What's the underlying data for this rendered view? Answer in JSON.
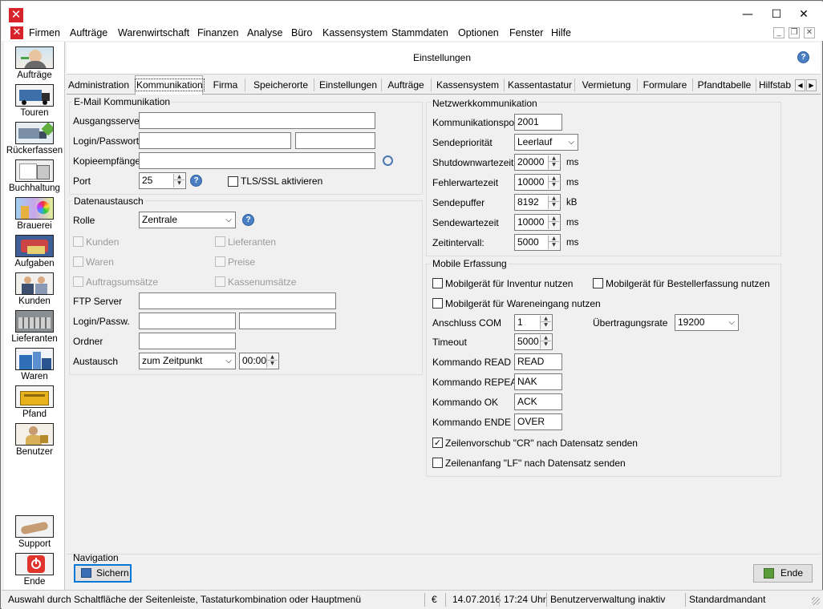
{
  "window": {
    "minimize": "—",
    "maximize": "☐",
    "close": "✕"
  },
  "menu": {
    "items": [
      "Firmen",
      "Aufträge",
      "Warenwirtschaft",
      "Finanzen",
      "Analyse",
      "Büro",
      "Kassensystem",
      "Stammdaten",
      "Optionen",
      "Fenster",
      "Hilfe"
    ],
    "mdi_minimize": "_",
    "mdi_restore": "❐",
    "mdi_close": "✕"
  },
  "sidebar": {
    "items": [
      "Aufträge",
      "Touren",
      "Rückerfassen",
      "Buchhaltung",
      "Brauerei",
      "Aufgaben",
      "Kunden",
      "Lieferanten",
      "Waren",
      "Pfand",
      "Benutzer"
    ],
    "support": "Support",
    "ende": "Ende"
  },
  "header": {
    "title": "Einstellungen",
    "help": "?"
  },
  "tabs": [
    "Administration",
    "Kommunikation",
    "Firma",
    "Speicherorte",
    "Einstellungen",
    "Aufträge",
    "Kassensystem",
    "Kassentastatur",
    "Vermietung",
    "Formulare",
    "Pfandtabelle",
    "Hilfstab"
  ],
  "tab_scroll": {
    "left": "◀",
    "right": "▶"
  },
  "email": {
    "title": "E-Mail Kommunikation",
    "ausgangsserver_label": "Ausgangsserver",
    "ausgangsserver_value": "",
    "login_label": "Login/Passwort",
    "login_value": "",
    "password_value": "",
    "kopie_label": "Kopieempfänger",
    "kopie_value": "",
    "port_label": "Port",
    "port_value": "25",
    "tls_label": "TLS/SSL aktivieren",
    "tls_checked": false
  },
  "daten": {
    "title": "Datenaustausch",
    "rolle_label": "Rolle",
    "rolle_value": "Zentrale",
    "kunden": "Kunden",
    "lieferanten": "Lieferanten",
    "waren": "Waren",
    "preise": "Preise",
    "auftragsumsaetze": "Auftragsumsätze",
    "kassenumsaetze": "Kassenumsätze",
    "ftp_label": "FTP Server",
    "ftp_value": "",
    "login_label": "Login/Passw.",
    "login_value": "",
    "password_value": "",
    "ordner_label": "Ordner",
    "ordner_value": "",
    "austausch_label": "Austausch",
    "austausch_value": "zum Zeitpunkt",
    "zeit_value": "00:00"
  },
  "netzwerk": {
    "title": "Netzwerkkommunikation",
    "port_label": "Kommunikationsport",
    "port_value": "2001",
    "prio_label": "Sendepriorität",
    "prio_value": "Leerlauf",
    "shutdown_label": "Shutdownwartezeit",
    "shutdown_value": "20000",
    "shutdown_unit": "ms",
    "fehler_label": "Fehlerwartezeit",
    "fehler_value": "10000",
    "fehler_unit": "ms",
    "puffer_label": "Sendepuffer",
    "puffer_value": "8192",
    "puffer_unit": "kB",
    "sendewarte_label": "Sendewartezeit",
    "sendewarte_value": "10000",
    "sendewarte_unit": "ms",
    "intervall_label": "Zeitintervall:",
    "intervall_value": "5000",
    "intervall_unit": "ms"
  },
  "mobile": {
    "title": "Mobile Erfassung",
    "inventur": "Mobilgerät für Inventur nutzen",
    "bestell": "Mobilgerät für Bestellerfassung nutzen",
    "wareneingang": "Mobilgerät für Wareneingang nutzen",
    "com_label": "Anschluss COM",
    "com_value": "1",
    "rate_label": "Übertragungsrate",
    "rate_value": "19200",
    "timeout_label": "Timeout",
    "timeout_value": "5000",
    "read_label": "Kommando READ",
    "read_value": "READ",
    "repeat_label": "Kommando REPEAT",
    "repeat_value": "NAK",
    "ok_label": "Kommando OK",
    "ok_value": "ACK",
    "ende_label": "Kommando ENDE",
    "ende_value": "OVER",
    "cr_label": "Zeilenvorschub \"CR\" nach Datensatz senden",
    "cr_checked": true,
    "lf_label": "Zeilenanfang \"LF\" nach Datensatz senden",
    "lf_checked": false
  },
  "navigation": {
    "title": "Navigation",
    "save": "Sichern",
    "end": "Ende"
  },
  "status": {
    "hint": "Auswahl durch Schaltfläche der Seitenleiste, Tastaturkombination oder Hauptmenü",
    "currency": "€",
    "date": "14.07.2016",
    "time": "17:24 Uhr",
    "user": "Benutzerverwaltung inaktiv",
    "mandant": "Standardmandant"
  },
  "colors": {
    "accent": "#0078d7",
    "app_icon": "#d8232a",
    "help_icon": "#4a7fc4"
  }
}
